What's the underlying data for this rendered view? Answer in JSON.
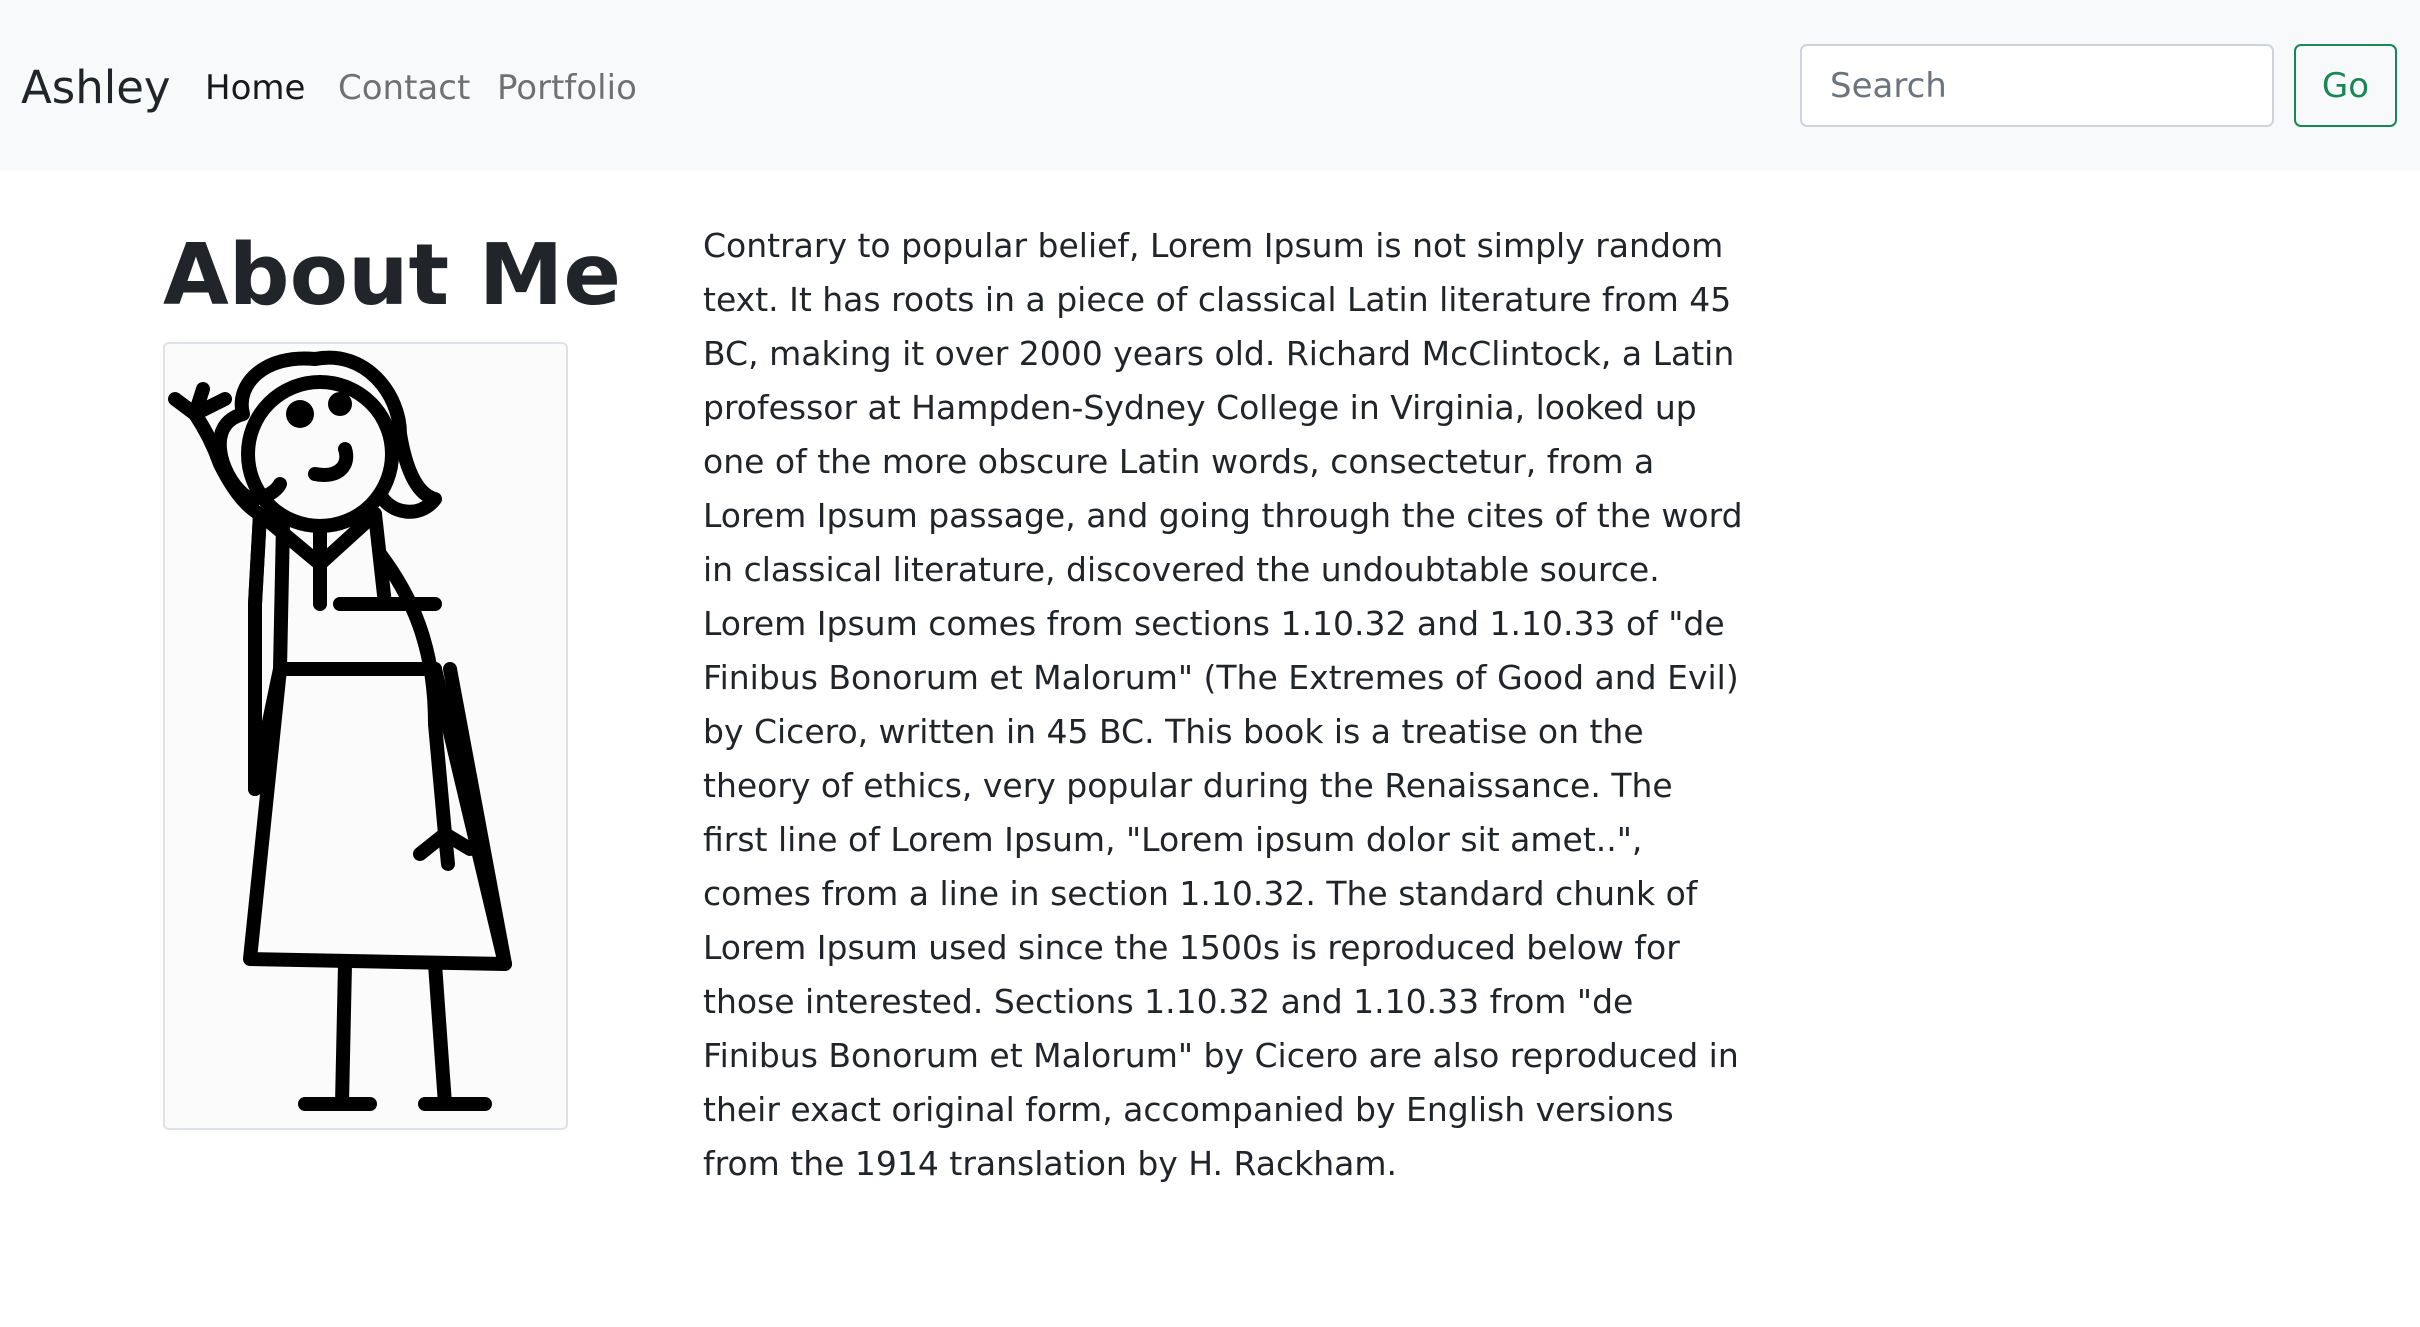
{
  "navbar": {
    "brand": "Ashley",
    "links": [
      {
        "label": "Home",
        "active": true
      },
      {
        "label": "Contact",
        "active": false
      },
      {
        "label": "Portfolio",
        "active": false
      }
    ],
    "search": {
      "placeholder": "Search",
      "value": ""
    },
    "go_label": "Go"
  },
  "main": {
    "title": "About Me",
    "portrait_alt": "stick figure girl waving",
    "bio": "Contrary to popular belief, Lorem Ipsum is not simply random text. It has roots in a piece of classical Latin literature from 45 BC, making it over 2000 years old. Richard McClintock, a Latin professor at Hampden-Sydney College in Virginia, looked up one of the more obscure Latin words, consectetur, from a Lorem Ipsum passage, and going through the cites of the word in classical literature, discovered the undoubtable source. Lorem Ipsum comes from sections 1.10.32 and 1.10.33 of \"de Finibus Bonorum et Malorum\" (The Extremes of Good and Evil) by Cicero, written in 45 BC. This book is a treatise on the theory of ethics, very popular during the Renaissance. The first line of Lorem Ipsum, \"Lorem ipsum dolor sit amet..\", comes from a line in section 1.10.32. The standard chunk of Lorem Ipsum used since the 1500s is reproduced below for those interested. Sections 1.10.32 and 1.10.33 from \"de Finibus Bonorum et Malorum\" by Cicero are also reproduced in their exact original form, accompanied by English versions from the 1914 translation by H. Rackham."
  },
  "colors": {
    "navbar_bg": "#f8f9fa",
    "success": "#198754",
    "text": "#212529",
    "muted_link": "#8c8c8c"
  }
}
